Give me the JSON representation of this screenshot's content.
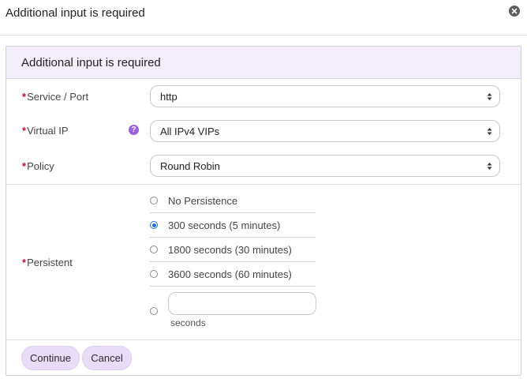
{
  "dialog": {
    "title": "Additional input is required",
    "close_icon": "close-circle-icon"
  },
  "panel": {
    "header": "Additional input is required"
  },
  "form": {
    "required_marker": "*",
    "service_port": {
      "label": "Service / Port",
      "value": "http"
    },
    "virtual_ip": {
      "label": "Virtual IP",
      "value": "All IPv4 VIPs",
      "help_icon": "question-icon",
      "help_glyph": "?"
    },
    "policy": {
      "label": "Policy",
      "value": "Round Robin"
    },
    "persistent": {
      "label": "Persistent",
      "options": [
        {
          "label": "No Persistence",
          "checked": false
        },
        {
          "label": "300 seconds (5 minutes)",
          "checked": true
        },
        {
          "label": "1800 seconds (30 minutes)",
          "checked": false
        },
        {
          "label": "3600 seconds (60 minutes)",
          "checked": false
        }
      ],
      "custom_value": "",
      "custom_unit": "seconds"
    }
  },
  "actions": {
    "continue_label": "Continue",
    "cancel_label": "Cancel"
  },
  "colors": {
    "header_bg": "#f3eef9",
    "button_bg": "#e8dcf8",
    "required": "#c8102e",
    "help_icon": "#9a62e0",
    "radio_checked": "#1a73e8"
  }
}
